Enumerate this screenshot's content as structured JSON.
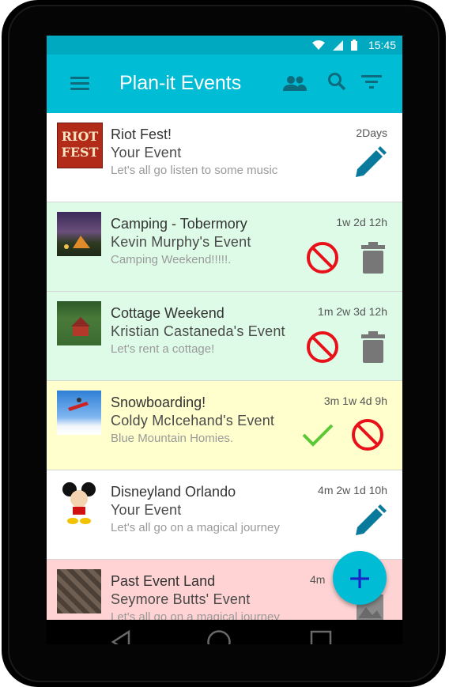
{
  "status_bar": {
    "time": "15:45"
  },
  "app_bar": {
    "title": "Plan-it Events"
  },
  "colors": {
    "accent": "#00bcd4",
    "status": "#00a8c0",
    "accepted": "#ddfbe7",
    "pending": "#ffffcd",
    "past": "#ffd3d3",
    "own": "#ffffff"
  },
  "events": [
    {
      "title": "Riot Fest!",
      "owner": "Your Event",
      "description": "Let's all go listen to some music",
      "time_left": "2Days",
      "thumb_text": "RIOT FEST"
    },
    {
      "title": "Camping - Tobermory",
      "owner": "Kevin Murphy's Event",
      "description": "Camping Weekend!!!!!.",
      "time_left": "1w 2d 12h"
    },
    {
      "title": "Cottage Weekend",
      "owner": "Kristian Castaneda's Event",
      "description": "Let's rent a cottage!",
      "time_left": "1m 2w 3d 12h"
    },
    {
      "title": "Snowboarding!",
      "owner": "Coldy McIcehand's Event",
      "description": "Blue Mountain Homies.",
      "time_left": "3m 1w 4d 9h"
    },
    {
      "title": "Disneyland Orlando",
      "owner": "Your Event",
      "description": "Let's all go on a magical journey",
      "time_left": "4m 2w 1d 10h"
    },
    {
      "title": "Past Event Land",
      "owner": "Seymore Butts' Event",
      "description": "Let's all go on a magical journey",
      "time_left": "4m"
    }
  ],
  "fab": {
    "label": "+"
  }
}
